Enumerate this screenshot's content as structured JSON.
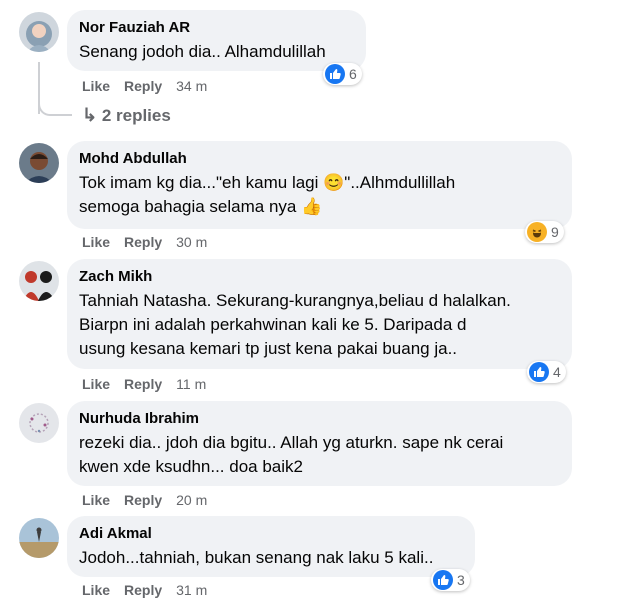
{
  "comments": [
    {
      "name": "Nor Fauziah AR",
      "lines": [
        "Senang jodoh dia.. Alhamdulillah"
      ],
      "like": "Like",
      "reply": "Reply",
      "time": "34 m",
      "reaction_count": "6",
      "reaction": "like-icon"
    },
    {
      "name": "Mohd Abdullah",
      "lines": [
        "Tok imam kg dia...\"eh kamu lagi 😊\"..Alhmdullillah",
        "semoga bahagia selama nya 👍"
      ],
      "like": "Like",
      "reply": "Reply",
      "time": "30 m",
      "reaction_count": "9",
      "reaction": "haha-icon"
    },
    {
      "name": "Zach Mikh",
      "lines": [
        "Tahniah Natasha. Sekurang-kurangnya,beliau d halalkan.",
        "Biarpn ini adalah perkahwinan kali ke 5. Daripada d",
        "usung kesana kemari tp just kena pakai buang ja.."
      ],
      "like": "Like",
      "reply": "Reply",
      "time": "11 m",
      "reaction_count": "4",
      "reaction": "like-icon"
    },
    {
      "name": "Nurhuda Ibrahim",
      "lines": [
        "rezeki dia.. jdoh dia bgitu.. Allah yg aturkn. sape nk cerai",
        "kwen xde ksudhn... doa baik2"
      ],
      "like": "Like",
      "reply": "Reply",
      "time": "20 m"
    },
    {
      "name": "Adi Akmal",
      "lines": [
        "Jodoh...tahniah, bukan senang nak laku 5 kali.."
      ],
      "like": "Like",
      "reply": "Reply",
      "time": "31 m",
      "reaction_count": "3",
      "reaction": "like-icon"
    }
  ],
  "replies_link": "2 replies",
  "colors": {
    "bubble": "#f0f2f5",
    "meta": "#65676b",
    "like_blue": "#1877f2",
    "haha_yellow": "#f7b125"
  }
}
